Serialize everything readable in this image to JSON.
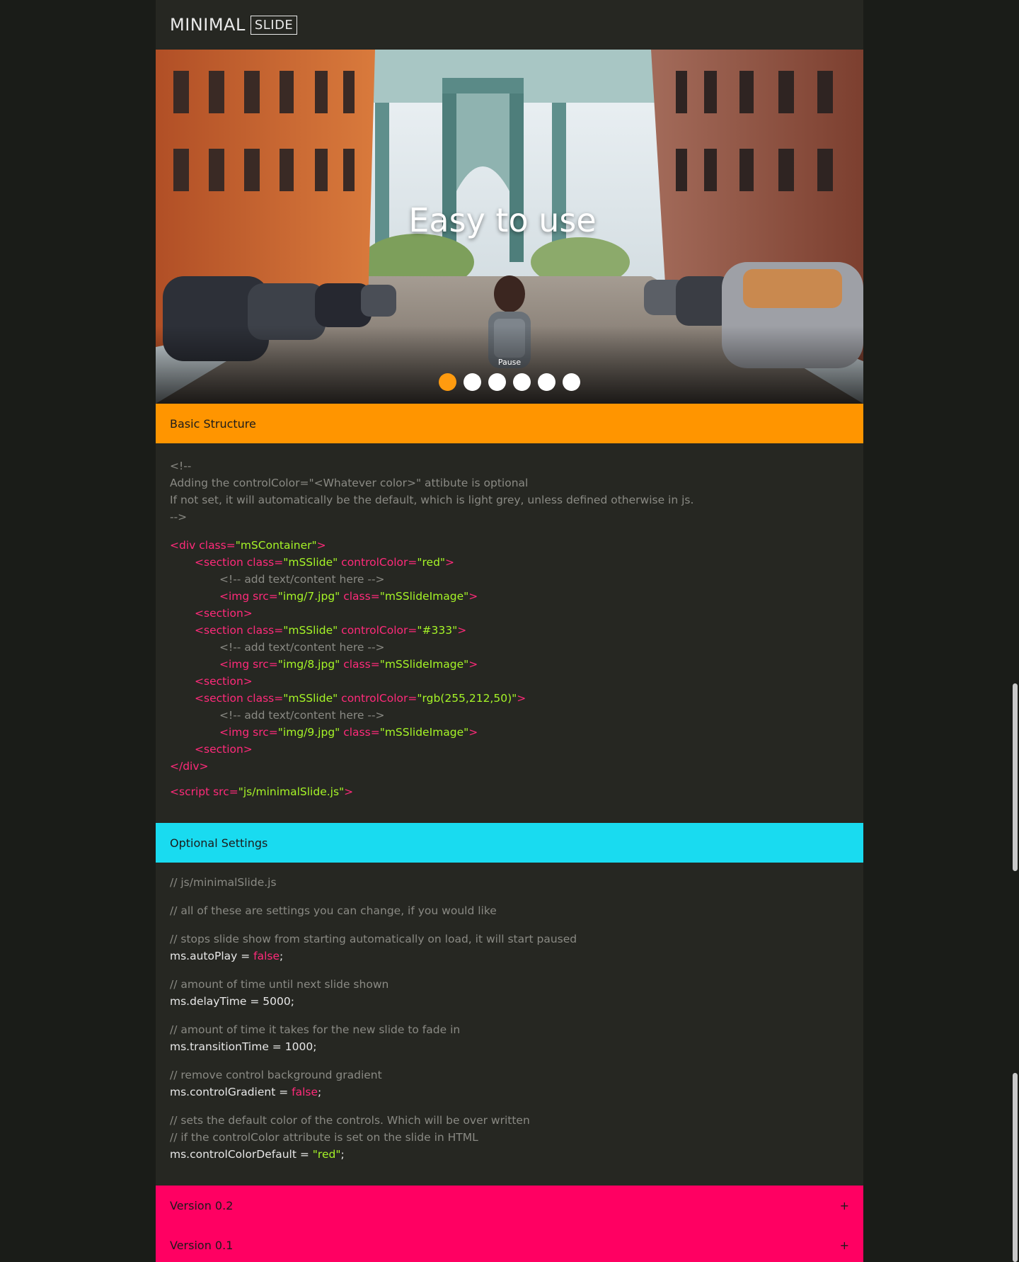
{
  "header": {
    "logo_main": "MINIMAL",
    "logo_box": "SLIDE"
  },
  "slider": {
    "title": "Easy to use",
    "pause_label": "Pause",
    "dots": [
      {
        "active": true,
        "color": "#ff9b0f"
      },
      {
        "active": false
      },
      {
        "active": false
      },
      {
        "active": false
      },
      {
        "active": false
      },
      {
        "active": false
      }
    ]
  },
  "basic_structure": {
    "title": "Basic Structure",
    "comment_lines": [
      "<!--",
      "Adding the controlColor=\"<Whatever color>\" attibute is optional",
      "If not set, it will automatically be the default, which is light grey, unless defined otherwise in js.",
      "-->"
    ],
    "open_div": {
      "tag": "<div ",
      "attr": "class=",
      "val": "\"mSContainer\"",
      "close": ">"
    },
    "sections": [
      {
        "open_tag": "<section ",
        "attr1": "class=",
        "val1": "\"mSSlide\"",
        "attr2": " controlColor=",
        "val2": "\"red\"",
        "close": ">",
        "comment": "<!-- add text/content here -->",
        "img_tag": "<img ",
        "img_attr1": "src=",
        "img_val1": "\"img/7.jpg\"",
        "img_attr2": " class=",
        "img_val2": "\"mSSlideImage\"",
        "img_close": ">",
        "end": "<section>"
      },
      {
        "open_tag": "<section ",
        "attr1": "class=",
        "val1": "\"mSSlide\"",
        "attr2": " controlColor=",
        "val2": "\"#333\"",
        "close": ">",
        "comment": "<!-- add text/content here -->",
        "img_tag": "<img ",
        "img_attr1": "src=",
        "img_val1": "\"img/8.jpg\"",
        "img_attr2": " class=",
        "img_val2": "\"mSSlideImage\"",
        "img_close": ">",
        "end": "<section>"
      },
      {
        "open_tag": "<section ",
        "attr1": "class=",
        "val1": "\"mSSlide\"",
        "attr2": " controlColor=",
        "val2": "\"rgb(255,212,50)\"",
        "close": ">",
        "comment": "<!-- add text/content here -->",
        "img_tag": "<img ",
        "img_attr1": "src=",
        "img_val1": "\"img/9.jpg\"",
        "img_attr2": " class=",
        "img_val2": "\"mSSlideImage\"",
        "img_close": ">",
        "end": "<section>"
      }
    ],
    "close_div": "</div>",
    "script": {
      "tag": "<script ",
      "attr": "src=",
      "val": "\"js/minimalSlide.js\"",
      "close": ">"
    }
  },
  "optional_settings": {
    "title": "Optional Settings",
    "file_comment": "// js/minimalSlide.js",
    "intro_comment": "// all of these are settings you can change, if you would like",
    "settings": [
      {
        "comments": [
          "// stops slide show from starting automatically on load, it will start paused"
        ],
        "prop": "ms.autoPlay = ",
        "value": "false",
        "value_kind": "false",
        "end": ";"
      },
      {
        "comments": [
          "// amount of time until next slide shown"
        ],
        "prop": "ms.delayTime = ",
        "value": "5000",
        "value_kind": "plain",
        "end": ";"
      },
      {
        "comments": [
          "// amount of time it takes for the new slide to fade in"
        ],
        "prop": "ms.transitionTime = ",
        "value": "1000",
        "value_kind": "plain",
        "end": ";"
      },
      {
        "comments": [
          "// remove control background gradient"
        ],
        "prop": "ms.controlGradient = ",
        "value": "false",
        "value_kind": "false",
        "end": ";"
      },
      {
        "comments": [
          "// sets the default color of the controls. Which will be over written",
          "// if the controlColor attribute is set on the slide in HTML"
        ],
        "prop": "ms.controlColorDefault = ",
        "value": "\"red\"",
        "value_kind": "string",
        "end": ";"
      }
    ]
  },
  "versions": [
    {
      "label": "Version 0.2",
      "toggle": "+"
    },
    {
      "label": "Version 0.1",
      "toggle": "+"
    }
  ],
  "colors": {
    "page_bg": "#1a1c18",
    "content_bg": "#262722",
    "orange": "#ff9500",
    "cyan": "#19dbf0",
    "pink": "#ff0062",
    "code_tag": "#ff2a7a",
    "code_string": "#a6f527",
    "code_comment": "#8a8a84"
  }
}
